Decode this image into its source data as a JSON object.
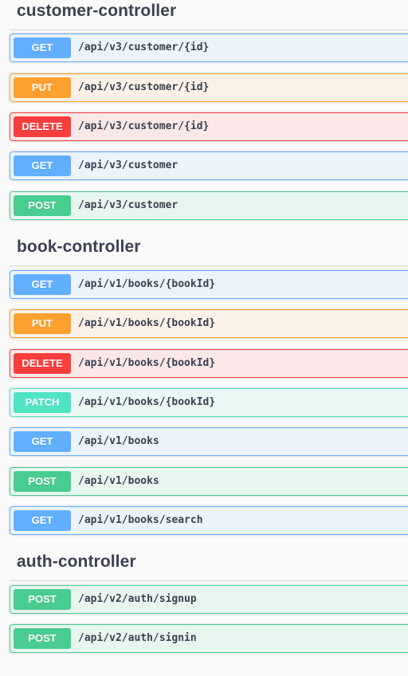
{
  "sections": [
    {
      "title": "customer-controller",
      "operations": [
        {
          "method": "GET",
          "path": "/api/v3/customer/{id}"
        },
        {
          "method": "PUT",
          "path": "/api/v3/customer/{id}"
        },
        {
          "method": "DELETE",
          "path": "/api/v3/customer/{id}"
        },
        {
          "method": "GET",
          "path": "/api/v3/customer"
        },
        {
          "method": "POST",
          "path": "/api/v3/customer"
        }
      ]
    },
    {
      "title": "book-controller",
      "operations": [
        {
          "method": "GET",
          "path": "/api/v1/books/{bookId}"
        },
        {
          "method": "PUT",
          "path": "/api/v1/books/{bookId}"
        },
        {
          "method": "DELETE",
          "path": "/api/v1/books/{bookId}"
        },
        {
          "method": "PATCH",
          "path": "/api/v1/books/{bookId}"
        },
        {
          "method": "GET",
          "path": "/api/v1/books"
        },
        {
          "method": "POST",
          "path": "/api/v1/books"
        },
        {
          "method": "GET",
          "path": "/api/v1/books/search"
        }
      ]
    },
    {
      "title": "auth-controller",
      "operations": [
        {
          "method": "POST",
          "path": "/api/v2/auth/signup"
        },
        {
          "method": "POST",
          "path": "/api/v2/auth/signin"
        }
      ]
    }
  ],
  "colors": {
    "get": "#61affe",
    "put": "#fca130",
    "delete": "#f93e3e",
    "post": "#49cc90",
    "patch": "#50e3c2",
    "title_text": "#3b4151"
  }
}
